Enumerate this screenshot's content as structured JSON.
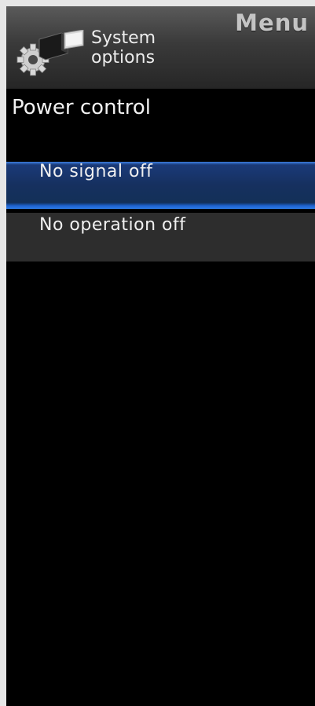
{
  "header": {
    "menu_title": "Menu",
    "section_icon": "system-options-icon",
    "section_label_line1": "System",
    "section_label_line2": "options"
  },
  "page": {
    "title": "Power control"
  },
  "items": [
    {
      "label": "No signal off",
      "selected": true
    },
    {
      "label": "No operation off",
      "selected": false
    }
  ],
  "colors": {
    "highlight": "#1d62cf",
    "background": "#000000",
    "item_background": "#2d2d2d"
  }
}
